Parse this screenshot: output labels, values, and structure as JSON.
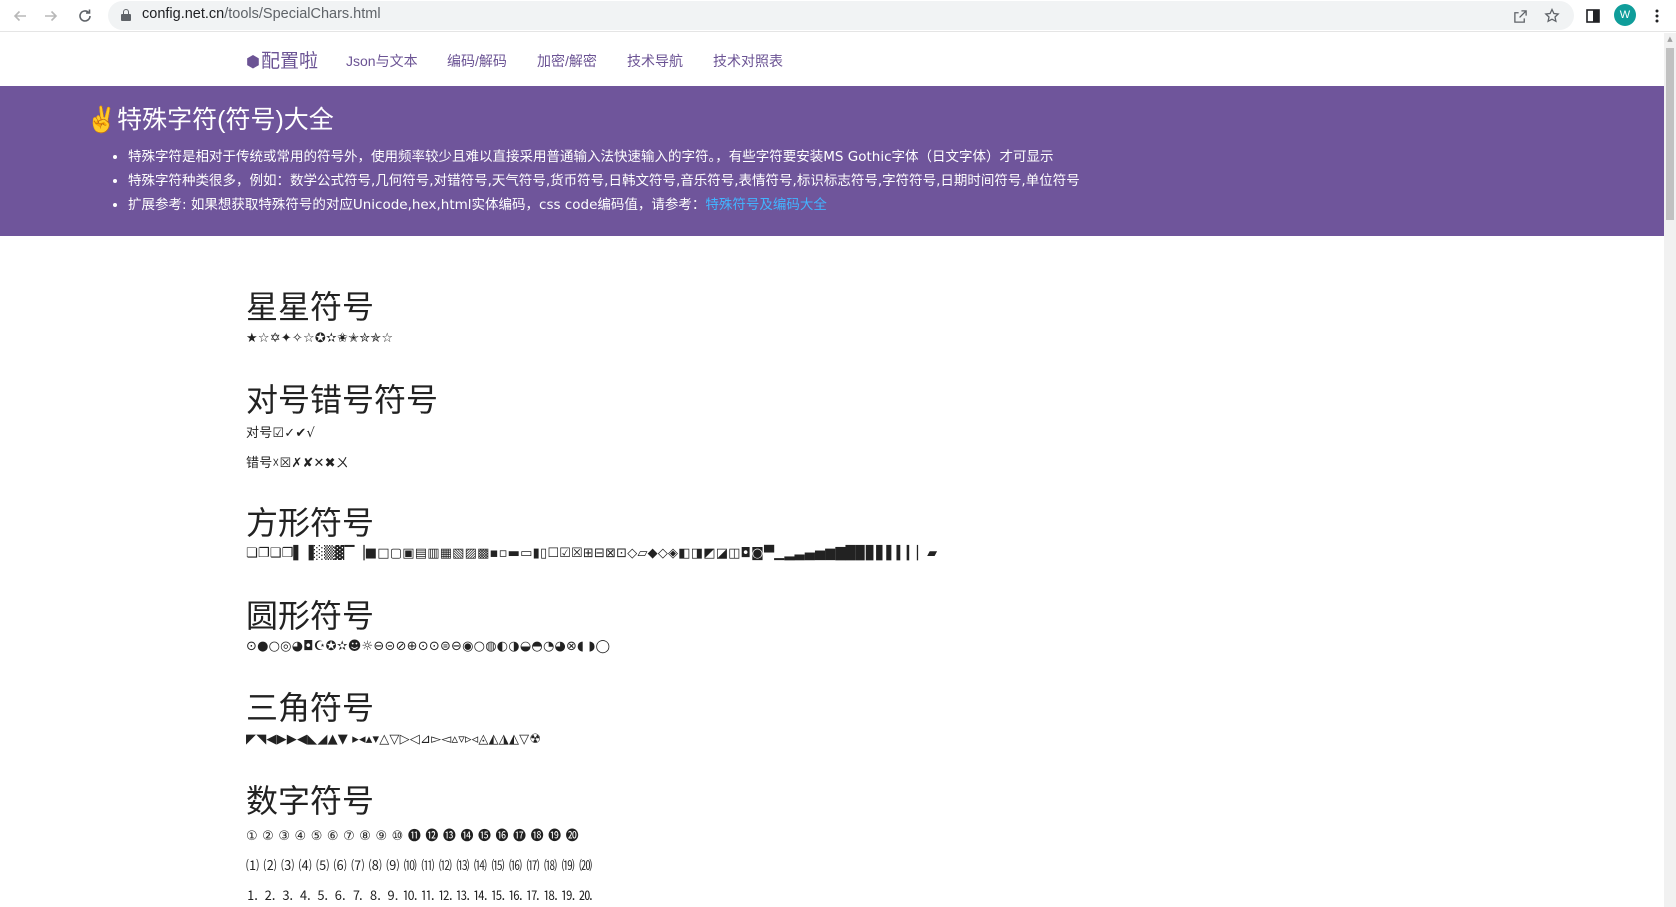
{
  "browser": {
    "url_host": "config.net.cn",
    "url_path": "/tools/SpecialChars.html",
    "profile_initial": "W",
    "icons": [
      "back-arrow-icon",
      "forward-arrow-icon",
      "reload-icon",
      "lock-icon",
      "share-icon",
      "star-icon",
      "side-panel-icon",
      "more-vert-icon"
    ]
  },
  "nav": {
    "brand_icon": "⬢",
    "brand": "配置啦",
    "links": [
      "Json与文本",
      "编码/解码",
      "加密/解密",
      "技术导航",
      "技术对照表"
    ]
  },
  "banner": {
    "title_icon": "✌",
    "title": "特殊字符(符号)大全",
    "items": [
      "特殊字符是相对于传统或常用的符号外，使用频率较少且难以直接采用普通输入法快速输入的字符。，有些字符要安装MS Gothic字体（日文字体）才可显示",
      "特殊字符种类很多，例如：数学公式符号,几何符号,对错符号,天气符号,货币符号,日韩文符号,音乐符号,表情符号,标识标志符号,字符符号,日期时间符号,单位符号",
      "扩展参考: 如果想获取特殊符号的对应Unicode,hex,html实体编码，css code编码值，请参考："
    ],
    "link_text": "特殊符号及编码大全"
  },
  "sections": {
    "stars": {
      "title": "星星符号",
      "symbols": "★☆✡✦✧☆✪✫✬✭✮✯☆"
    },
    "check": {
      "title": "对号错号符号",
      "check_line": "对号☑✓✔√",
      "cross_line": "错号☓☒✗✘✕✖ㄨ"
    },
    "square": {
      "title": "方形符号",
      "symbols": "❏❐❑❒▌▐░▒▓▔▕■□▢▣▤▥▦▧▨▩▪▫▬▭▮▯☐☑☒⊞⊟⊠⊡◇▱◆◇◈◧◨◩◪◫◘◙▀▁▂▃▄▅▆▇█▉▊▋▌▍▎▏▰"
    },
    "circle": {
      "title": "圆形符号",
      "symbols": "⊙●○◎◕◘☪✪✫☻☼⊖⊝⊘⊕⊙⊙⊜⊖◉○◍◐◑◒◓◔◕⊗◖ ◗◯"
    },
    "triangle": {
      "title": "三角符号",
      "symbols": "◤◥◀▶▶◀◣◢▲▼ ▸◂▴▾△▽▷◁⊿▻◅▵▿▹◃◬◭◮◭▽☢"
    },
    "numbers": {
      "title": "数字符号",
      "line1": "① ② ③ ④ ⑤ ⑥ ⑦ ⑧ ⑨ ⑩ ⓫ ⓬ ⓭ ⓮ ⓯ ⓰ ⓱ ⓲ ⓳ ⓴",
      "line2": "⑴ ⑵ ⑶ ⑷ ⑸ ⑹ ⑺ ⑻ ⑼ ⑽ ⑾ ⑿ ⒀ ⒁ ⒂ ⒃ ⒄ ⒅ ⒆ ⒇",
      "line3": "⒈ ⒉ ⒊ ⒋ ⒌ ⒍ ⒎ ⒏ ⒐ ⒑ ⒒ ⒓ ⒔ ⒕ ⒖ ⒗ ⒘ ⒙ ⒚ ⒛"
    }
  }
}
